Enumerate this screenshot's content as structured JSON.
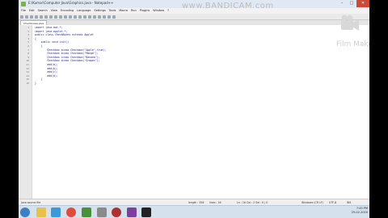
{
  "window": {
    "title": "E:\\Kumar\\Computer Java\\Graphics.java - Notepad++",
    "minimize": "–",
    "maximize": "□",
    "close": "✕"
  },
  "menu": [
    "File",
    "Edit",
    "Search",
    "View",
    "Encoding",
    "Language",
    "Settings",
    "Tools",
    "Macro",
    "Run",
    "Plugins",
    "Window",
    "?"
  ],
  "tab": {
    "label": "Checkboxes.java"
  },
  "code_lines": [
    {
      "n": "1",
      "text": "import java.awt.*;"
    },
    {
      "n": "2",
      "text": "import java.applet.*;"
    },
    {
      "n": "3",
      "text": "public class CheckBoxes extends Applet"
    },
    {
      "n": "4",
      "text": "{"
    },
    {
      "n": "5",
      "text": "    public void init()"
    },
    {
      "n": "6",
      "text": "    {"
    },
    {
      "n": "7",
      "text": "        Checkbox a=new Checkbox(\"Apple\",true);"
    },
    {
      "n": "8",
      "text": "        Checkbox b=new Checkbox(\"Mango\");"
    },
    {
      "n": "9",
      "text": "        Checkbox c=new Checkbox(\"Banana\");"
    },
    {
      "n": "10",
      "text": "        Checkbox d=new Checkbox(\"Grapes\");"
    },
    {
      "n": "11",
      "text": "        add(a);"
    },
    {
      "n": "12",
      "text": "        add(b);"
    },
    {
      "n": "13",
      "text": "        add(c);"
    },
    {
      "n": "14",
      "text": "        add(d);"
    },
    {
      "n": "15",
      "text": "    }"
    },
    {
      "n": "16",
      "text": "}"
    }
  ],
  "status": {
    "file_type": "Java source file",
    "length": "length : 356",
    "lines": "lines : 16",
    "position": "Ln : 16    Col : 2    Sel : 0 | 0",
    "eol": "Windows (CR LF)",
    "encoding": "UTF-8",
    "mode": "INS"
  },
  "taskbar": {
    "time": "7:45 PM",
    "date": "25-02-2020"
  },
  "watermark": "www.BANDICAM.com",
  "filmmaker": "Film Maker",
  "colors": {
    "taskbar": "#d6e1ee",
    "close": "#c94b3a",
    "code": "#1a1a8a"
  }
}
